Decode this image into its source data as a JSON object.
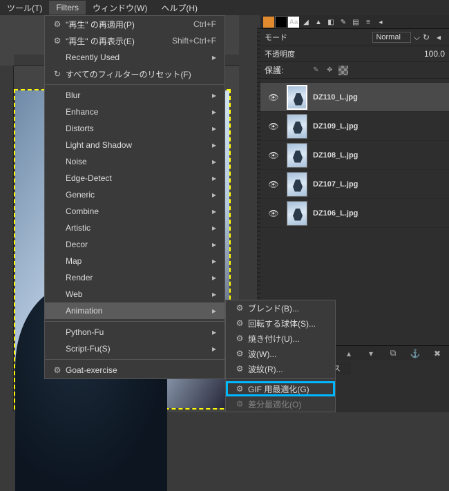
{
  "menubar": {
    "tools": "ツール(T)",
    "filters": "Filters",
    "window": "ウィンドウ(W)",
    "help": "ヘルプ(H)"
  },
  "filters_menu": {
    "repeat_apply": "\"再生\" の再適用(P)",
    "repeat_apply_accel": "Ctrl+F",
    "repeat_show": "\"再生\" の再表示(E)",
    "repeat_show_accel": "Shift+Ctrl+F",
    "recently_used": "Recently Used",
    "reset_all": "すべてのフィルターのリセット(F)",
    "groups": {
      "blur": "Blur",
      "enhance": "Enhance",
      "distorts": "Distorts",
      "light_shadow": "Light and Shadow",
      "noise": "Noise",
      "edge_detect": "Edge-Detect",
      "generic": "Generic",
      "combine": "Combine",
      "artistic": "Artistic",
      "decor": "Decor",
      "map": "Map",
      "render": "Render",
      "web": "Web",
      "animation": "Animation"
    },
    "python_fu": "Python-Fu",
    "script_fu": "Script-Fu(S)",
    "goat": "Goat-exercise"
  },
  "animation_submenu": {
    "blend": "ブレンド(B)...",
    "sphere": "回転する球体(S)...",
    "burn": "焼き付け(U)...",
    "wave": "波(W)...",
    "ripple": "波紋(R)...",
    "gif_optimize": "GIF 用最適化(G)",
    "diff_optimize": "差分最適化(O)"
  },
  "layers_panel": {
    "mode_label": "モード",
    "mode_value": "Normal",
    "opacity_label": "不透明度",
    "opacity_value": "100.0",
    "lock_label": "保護:",
    "items": [
      {
        "name": "DZ110_L.jpg"
      },
      {
        "name": "DZ109_L.jpg"
      },
      {
        "name": "DZ108_L.jpg"
      },
      {
        "name": "DZ107_L.jpg"
      },
      {
        "name": "DZ106_L.jpg"
      }
    ]
  },
  "tab_stub": "ス"
}
